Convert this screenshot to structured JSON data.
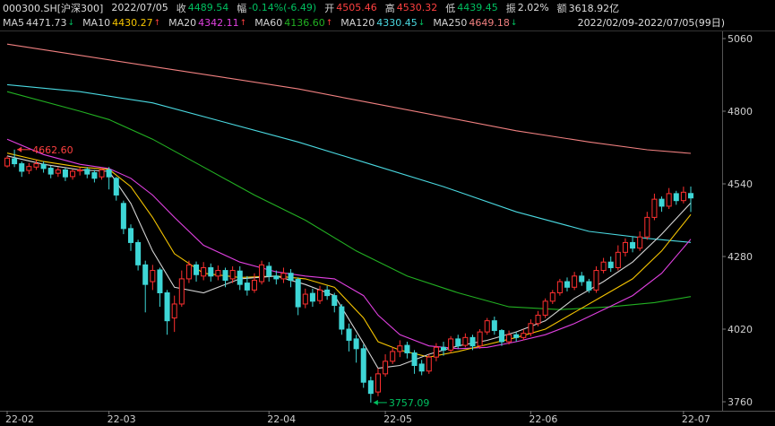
{
  "header": {
    "symbol": "000300.SH[沪深300]",
    "date": "2022/07/05",
    "close_label": "收",
    "close": "4489.54",
    "change_label": "幅",
    "change": "-0.14%(-6.49)",
    "open_label": "开",
    "open": "4505.46",
    "high_label": "高",
    "high": "4530.32",
    "low_label": "低",
    "low": "4439.45",
    "amp_label": "振",
    "amp": "2.02%",
    "amount_label": "额",
    "amount": "3618.92亿"
  },
  "ma_legend": [
    {
      "label": "MA5",
      "value": "4471.73",
      "arrow": "↓",
      "color": "#d4d4d4",
      "arrow_color": "#00c060"
    },
    {
      "label": "MA10",
      "value": "4430.27",
      "arrow": "↑",
      "color": "#f5c400",
      "arrow_color": "#ff4040"
    },
    {
      "label": "MA20",
      "value": "4342.11",
      "arrow": "↑",
      "color": "#e040e0",
      "arrow_color": "#ff4040"
    },
    {
      "label": "MA60",
      "value": "4136.60",
      "arrow": "↑",
      "color": "#22b022",
      "arrow_color": "#ff4040"
    },
    {
      "label": "MA120",
      "value": "4330.45",
      "arrow": "↓",
      "color": "#4ad8e0",
      "arrow_color": "#00c060"
    },
    {
      "label": "MA250",
      "value": "4649.18",
      "arrow": "↓",
      "color": "#f08080",
      "arrow_color": "#00c060"
    }
  ],
  "date_range": "2022/02/09-2022/07/05(99日)",
  "chart_data": {
    "type": "candlestick",
    "y_ticks": [
      "5060",
      "4800",
      "4540",
      "4280",
      "4020",
      "3760"
    ],
    "ylim": [
      3740,
      5100
    ],
    "x_ticks": [
      {
        "label": "22-02",
        "index": 0
      },
      {
        "label": "22-03",
        "index": 14
      },
      {
        "label": "22-04",
        "index": 36
      },
      {
        "label": "22-05",
        "index": 52
      },
      {
        "label": "22-06",
        "index": 72
      },
      {
        "label": "22-07",
        "index": 93
      }
    ],
    "annotations": [
      {
        "text": "4662.60",
        "index": 1,
        "value": 4662.6,
        "color": "#ff4040"
      },
      {
        "text": "3757.09",
        "index": 50,
        "value": 3757.09,
        "color": "#00c060"
      }
    ],
    "up_color": "#ff3030",
    "down_color": "#3ed6d6",
    "candles": [
      [
        4604,
        4632,
        4640,
        4598
      ],
      [
        4630,
        4612,
        4662.6,
        4600
      ],
      [
        4612,
        4585,
        4620,
        4565
      ],
      [
        4588,
        4602,
        4615,
        4575
      ],
      [
        4600,
        4612,
        4625,
        4590
      ],
      [
        4610,
        4595,
        4620,
        4580
      ],
      [
        4596,
        4575,
        4605,
        4560
      ],
      [
        4578,
        4590,
        4600,
        4565
      ],
      [
        4590,
        4565,
        4597,
        4550
      ],
      [
        4566,
        4585,
        4592,
        4555
      ],
      [
        4586,
        4590,
        4598,
        4570
      ],
      [
        4592,
        4575,
        4600,
        4560
      ],
      [
        4580,
        4560,
        4590,
        4545
      ],
      [
        4565,
        4590,
        4598,
        4555
      ],
      [
        4590,
        4565,
        4600,
        4520
      ],
      [
        4560,
        4500,
        4565,
        4480
      ],
      [
        4470,
        4380,
        4480,
        4360
      ],
      [
        4380,
        4330,
        4395,
        4300
      ],
      [
        4330,
        4250,
        4340,
        4230
      ],
      [
        4250,
        4180,
        4265,
        4080
      ],
      [
        4190,
        4230,
        4250,
        4160
      ],
      [
        4232,
        4150,
        4240,
        4100
      ],
      [
        4150,
        4050,
        4160,
        4000
      ],
      [
        4060,
        4110,
        4140,
        4010
      ],
      [
        4110,
        4200,
        4230,
        4100
      ],
      [
        4200,
        4250,
        4265,
        4185
      ],
      [
        4250,
        4215,
        4262,
        4190
      ],
      [
        4210,
        4240,
        4260,
        4195
      ],
      [
        4240,
        4210,
        4255,
        4190
      ],
      [
        4210,
        4230,
        4248,
        4195
      ],
      [
        4230,
        4195,
        4240,
        4170
      ],
      [
        4200,
        4230,
        4245,
        4185
      ],
      [
        4228,
        4180,
        4245,
        4160
      ],
      [
        4185,
        4160,
        4210,
        4140
      ],
      [
        4160,
        4195,
        4220,
        4150
      ],
      [
        4190,
        4250,
        4265,
        4180
      ],
      [
        4245,
        4210,
        4260,
        4190
      ],
      [
        4210,
        4200,
        4230,
        4180
      ],
      [
        4200,
        4220,
        4240,
        4185
      ],
      [
        4220,
        4195,
        4235,
        4170
      ],
      [
        4198,
        4100,
        4205,
        4070
      ],
      [
        4110,
        4145,
        4165,
        4095
      ],
      [
        4148,
        4120,
        4165,
        4100
      ],
      [
        4122,
        4160,
        4175,
        4110
      ],
      [
        4160,
        4140,
        4175,
        4125
      ],
      [
        4140,
        4105,
        4150,
        4080
      ],
      [
        4100,
        4020,
        4110,
        4000
      ],
      [
        4020,
        3980,
        4040,
        3940
      ],
      [
        3985,
        3950,
        4000,
        3900
      ],
      [
        3950,
        3830,
        3965,
        3810
      ],
      [
        3835,
        3790,
        3850,
        3757.09
      ],
      [
        3795,
        3860,
        3880,
        3780
      ],
      [
        3860,
        3905,
        3930,
        3850
      ],
      [
        3905,
        3940,
        3955,
        3895
      ],
      [
        3940,
        3960,
        3980,
        3920
      ],
      [
        3962,
        3935,
        3975,
        3915
      ],
      [
        3935,
        3890,
        3945,
        3860
      ],
      [
        3895,
        3870,
        3910,
        3855
      ],
      [
        3870,
        3920,
        3930,
        3860
      ],
      [
        3920,
        3955,
        3970,
        3905
      ],
      [
        3955,
        3945,
        3975,
        3925
      ],
      [
        3945,
        3985,
        3995,
        3935
      ],
      [
        3985,
        3960,
        4000,
        3950
      ],
      [
        3962,
        3990,
        4005,
        3955
      ],
      [
        3990,
        3960,
        4000,
        3945
      ],
      [
        3960,
        4010,
        4020,
        3950
      ],
      [
        4010,
        4050,
        4060,
        4000
      ],
      [
        4050,
        4015,
        4065,
        4000
      ],
      [
        4015,
        3975,
        4020,
        3960
      ],
      [
        3975,
        4000,
        4015,
        3965
      ],
      [
        4000,
        3990,
        4010,
        3975
      ],
      [
        3990,
        4005,
        4020,
        3980
      ],
      [
        4005,
        4040,
        4055,
        3995
      ],
      [
        4040,
        4070,
        4085,
        4030
      ],
      [
        4070,
        4120,
        4130,
        4060
      ],
      [
        4120,
        4150,
        4160,
        4110
      ],
      [
        4150,
        4190,
        4200,
        4140
      ],
      [
        4190,
        4170,
        4205,
        4155
      ],
      [
        4170,
        4210,
        4225,
        4160
      ],
      [
        4210,
        4190,
        4225,
        4175
      ],
      [
        4190,
        4160,
        4200,
        4150
      ],
      [
        4160,
        4230,
        4245,
        4150
      ],
      [
        4230,
        4260,
        4275,
        4220
      ],
      [
        4260,
        4240,
        4280,
        4225
      ],
      [
        4240,
        4295,
        4320,
        4230
      ],
      [
        4295,
        4330,
        4345,
        4280
      ],
      [
        4330,
        4310,
        4350,
        4295
      ],
      [
        4310,
        4350,
        4370,
        4300
      ],
      [
        4350,
        4420,
        4440,
        4340
      ],
      [
        4420,
        4485,
        4505,
        4410
      ],
      [
        4485,
        4460,
        4495,
        4440
      ],
      [
        4460,
        4505,
        4525,
        4450
      ],
      [
        4505,
        4480,
        4515,
        4465
      ],
      [
        4480,
        4510,
        4530,
        4470
      ],
      [
        4505.46,
        4489.54,
        4530.32,
        4439.45
      ]
    ],
    "ma_series": [
      {
        "name": "MA5",
        "color": "#d4d4d4",
        "values": [
          [
            0,
            4640
          ],
          [
            5,
            4610
          ],
          [
            10,
            4590
          ],
          [
            14,
            4585
          ],
          [
            17,
            4470
          ],
          [
            20,
            4300
          ],
          [
            23,
            4170
          ],
          [
            27,
            4150
          ],
          [
            32,
            4200
          ],
          [
            37,
            4210
          ],
          [
            41,
            4180
          ],
          [
            45,
            4140
          ],
          [
            49,
            3970
          ],
          [
            51,
            3880
          ],
          [
            54,
            3890
          ],
          [
            58,
            3930
          ],
          [
            62,
            3960
          ],
          [
            66,
            3980
          ],
          [
            70,
            4010
          ],
          [
            74,
            4050
          ],
          [
            78,
            4130
          ],
          [
            82,
            4190
          ],
          [
            86,
            4260
          ],
          [
            90,
            4360
          ],
          [
            94,
            4471.73
          ]
        ]
      },
      {
        "name": "MA10",
        "color": "#f5c400",
        "values": [
          [
            0,
            4650
          ],
          [
            5,
            4620
          ],
          [
            10,
            4600
          ],
          [
            14,
            4592
          ],
          [
            17,
            4530
          ],
          [
            20,
            4420
          ],
          [
            23,
            4290
          ],
          [
            27,
            4220
          ],
          [
            32,
            4205
          ],
          [
            37,
            4210
          ],
          [
            41,
            4200
          ],
          [
            45,
            4170
          ],
          [
            49,
            4060
          ],
          [
            51,
            3975
          ],
          [
            54,
            3945
          ],
          [
            58,
            3920
          ],
          [
            62,
            3940
          ],
          [
            66,
            3965
          ],
          [
            70,
            3990
          ],
          [
            74,
            4020
          ],
          [
            78,
            4080
          ],
          [
            82,
            4140
          ],
          [
            86,
            4200
          ],
          [
            90,
            4300
          ],
          [
            94,
            4430.27
          ]
        ]
      },
      {
        "name": "MA20",
        "color": "#e040e0",
        "values": [
          [
            0,
            4700
          ],
          [
            5,
            4645
          ],
          [
            10,
            4610
          ],
          [
            14,
            4595
          ],
          [
            17,
            4560
          ],
          [
            20,
            4500
          ],
          [
            23,
            4420
          ],
          [
            27,
            4320
          ],
          [
            32,
            4260
          ],
          [
            37,
            4225
          ],
          [
            41,
            4210
          ],
          [
            45,
            4200
          ],
          [
            49,
            4140
          ],
          [
            51,
            4070
          ],
          [
            54,
            4000
          ],
          [
            58,
            3960
          ],
          [
            62,
            3950
          ],
          [
            66,
            3955
          ],
          [
            70,
            3975
          ],
          [
            74,
            4000
          ],
          [
            78,
            4040
          ],
          [
            82,
            4090
          ],
          [
            86,
            4140
          ],
          [
            90,
            4220
          ],
          [
            94,
            4342.11
          ]
        ]
      },
      {
        "name": "MA60",
        "color": "#22b022",
        "values": [
          [
            0,
            4870
          ],
          [
            10,
            4800
          ],
          [
            14,
            4770
          ],
          [
            20,
            4700
          ],
          [
            27,
            4600
          ],
          [
            34,
            4500
          ],
          [
            41,
            4410
          ],
          [
            48,
            4300
          ],
          [
            55,
            4210
          ],
          [
            62,
            4150
          ],
          [
            69,
            4100
          ],
          [
            76,
            4090
          ],
          [
            83,
            4100
          ],
          [
            89,
            4115
          ],
          [
            94,
            4136.6
          ]
        ]
      },
      {
        "name": "MA120",
        "color": "#4ad8e0",
        "values": [
          [
            0,
            4895
          ],
          [
            10,
            4870
          ],
          [
            20,
            4830
          ],
          [
            30,
            4760
          ],
          [
            40,
            4690
          ],
          [
            50,
            4610
          ],
          [
            60,
            4530
          ],
          [
            70,
            4440
          ],
          [
            80,
            4370
          ],
          [
            88,
            4345
          ],
          [
            94,
            4330.45
          ]
        ]
      },
      {
        "name": "MA250",
        "color": "#f08080",
        "values": [
          [
            0,
            5040
          ],
          [
            10,
            5000
          ],
          [
            20,
            4960
          ],
          [
            30,
            4920
          ],
          [
            40,
            4880
          ],
          [
            50,
            4830
          ],
          [
            60,
            4780
          ],
          [
            70,
            4730
          ],
          [
            80,
            4690
          ],
          [
            88,
            4662
          ],
          [
            94,
            4649.18
          ]
        ]
      }
    ]
  }
}
